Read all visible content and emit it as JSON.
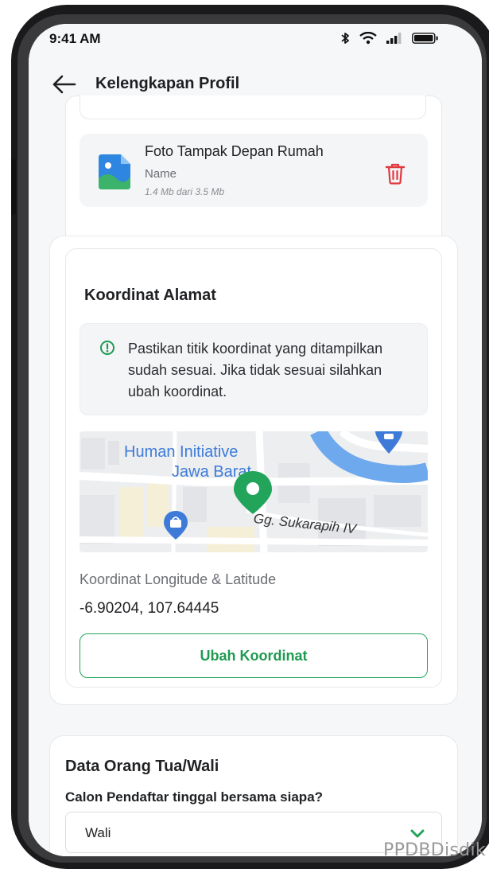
{
  "status_bar": {
    "time": "9:41 AM"
  },
  "header": {
    "title": "Kelengkapan Profil"
  },
  "upload": {
    "file_title": "Foto Tampak Depan Rumah",
    "file_name": "Name",
    "file_size": "1.4 Mb dari 3.5 Mb"
  },
  "coordinates": {
    "title": "Koordinat Alamat",
    "notice": "Pastikan titik koordinat yang ditampilkan sudah sesuai. Jika tidak sesuai silahkan ubah koordinat.",
    "map_labels": {
      "place_line1": "Human Initiative",
      "place_line2": "Jawa Barat",
      "street": "Gg. Sukarapih IV"
    },
    "field_label": "Koordinat Longitude & Latitude",
    "value": "-6.90204, 107.64445",
    "button_label": "Ubah Koordinat"
  },
  "parent": {
    "title": "Data Orang Tua/Wali",
    "question": "Calon Pendaftar tinggal bersama siapa?",
    "selected": "Wali"
  },
  "watermark": "PPDBDisdik",
  "colors": {
    "primary_green": "#22a55a",
    "danger_red": "#e0383e",
    "info_blue": "#3e7bd9",
    "background": "#f6f7f8"
  }
}
